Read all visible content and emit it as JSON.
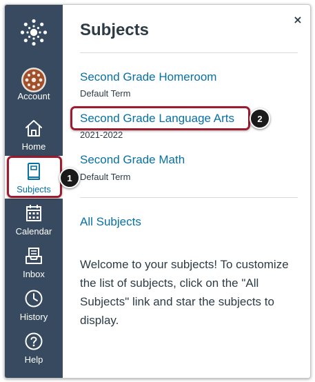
{
  "sidebar": {
    "logo_icon": "canvas-logo-icon",
    "items": [
      {
        "label": "Account",
        "icon": "avatar-icon",
        "active": false
      },
      {
        "label": "Home",
        "icon": "home-icon",
        "active": false
      },
      {
        "label": "Subjects",
        "icon": "book-icon",
        "active": true
      },
      {
        "label": "Calendar",
        "icon": "calendar-icon",
        "active": false
      },
      {
        "label": "Inbox",
        "icon": "inbox-icon",
        "active": false
      },
      {
        "label": "History",
        "icon": "clock-icon",
        "active": false
      },
      {
        "label": "Help",
        "icon": "help-icon",
        "active": false
      }
    ]
  },
  "panel": {
    "title": "Subjects",
    "close_icon": "close-icon",
    "close_glyph": "×",
    "subjects": [
      {
        "name": "Second Grade Homeroom",
        "term": "Default Term"
      },
      {
        "name": "Second Grade Language Arts",
        "term": "2021-2022"
      },
      {
        "name": "Second Grade Math",
        "term": "Default Term"
      }
    ],
    "all_link": "All Subjects",
    "welcome_text": "Welcome to your subjects! To customize the list of subjects, click on the \"All Subjects\" link and star the subjects to display."
  },
  "callouts": [
    {
      "number": "1",
      "target": "Subjects"
    },
    {
      "number": "2",
      "target": "Second Grade Language Arts"
    }
  ],
  "colors": {
    "sidebar_bg": "#384a5f",
    "link": "#0770a3",
    "text": "#2d3b45",
    "callout_border": "#9b1c2e",
    "badge_bg": "#1a1a1a"
  }
}
